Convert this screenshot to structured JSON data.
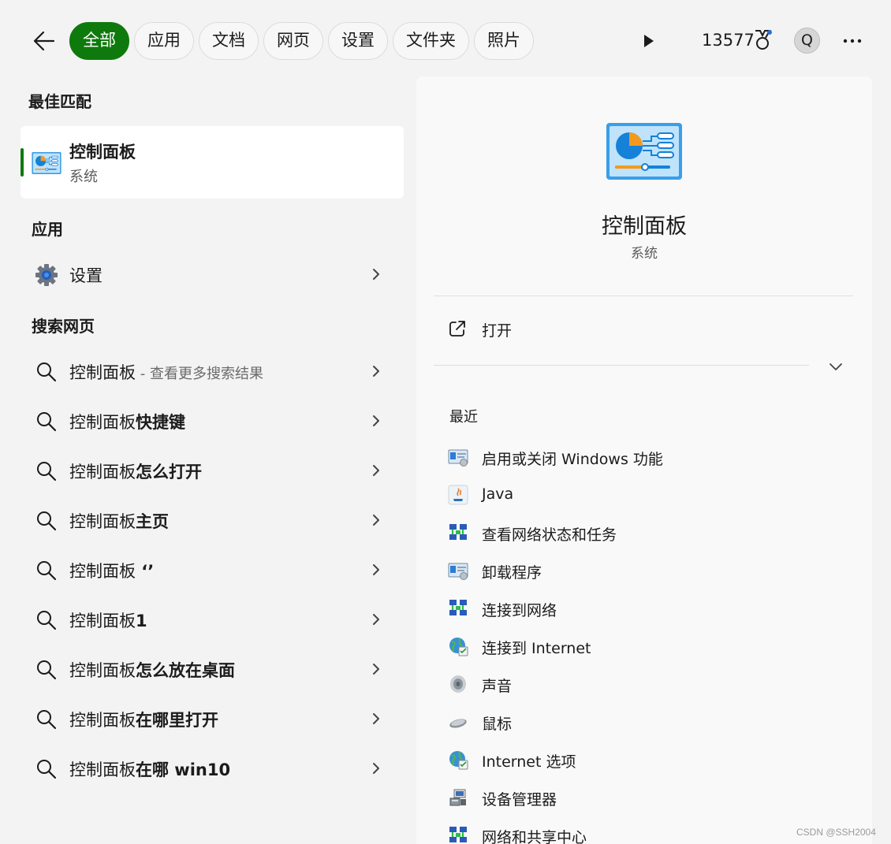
{
  "filters": {
    "tabs": [
      {
        "label": "全部",
        "active": true
      },
      {
        "label": "应用"
      },
      {
        "label": "文档"
      },
      {
        "label": "网页"
      },
      {
        "label": "设置"
      },
      {
        "label": "文件夹"
      },
      {
        "label": "照片"
      }
    ],
    "points": "13577",
    "avatar_letter": "Q"
  },
  "best_match": {
    "section_title": "最佳匹配",
    "title": "控制面板",
    "subtitle": "系统"
  },
  "apps": {
    "section_title": "应用",
    "items": [
      {
        "label": "设置",
        "icon": "gear-icon"
      }
    ]
  },
  "web": {
    "section_title": "搜索网页",
    "items": [
      {
        "prefix": "控制面板",
        "suffix": "",
        "hint": " - 查看更多搜索结果"
      },
      {
        "prefix": "控制面板",
        "suffix": "快捷键",
        "hint": ""
      },
      {
        "prefix": "控制面板",
        "suffix": "怎么打开",
        "hint": ""
      },
      {
        "prefix": "控制面板",
        "suffix": "主页",
        "hint": ""
      },
      {
        "prefix": "控制面板",
        "suffix": " ‘’",
        "hint": ""
      },
      {
        "prefix": "控制面板",
        "suffix": "1",
        "hint": ""
      },
      {
        "prefix": "控制面板",
        "suffix": "怎么放在桌面",
        "hint": ""
      },
      {
        "prefix": "控制面板",
        "suffix": "在哪里打开",
        "hint": ""
      },
      {
        "prefix": "控制面板",
        "suffix": "在哪 win10",
        "hint": ""
      }
    ]
  },
  "detail": {
    "title": "控制面板",
    "subtitle": "系统",
    "open_label": "打开",
    "recent_title": "最近",
    "recent": [
      {
        "label": "启用或关闭 Windows 功能",
        "icon": "programs-icon"
      },
      {
        "label": "Java",
        "icon": "java-icon"
      },
      {
        "label": "查看网络状态和任务",
        "icon": "network-icon"
      },
      {
        "label": "卸载程序",
        "icon": "programs-icon"
      },
      {
        "label": "连接到网络",
        "icon": "network-icon"
      },
      {
        "label": "连接到 Internet",
        "icon": "globe-icon"
      },
      {
        "label": "声音",
        "icon": "speaker-icon"
      },
      {
        "label": "鼠标",
        "icon": "mouse-icon"
      },
      {
        "label": "Internet 选项",
        "icon": "globe-icon"
      },
      {
        "label": "设备管理器",
        "icon": "device-manager-icon"
      },
      {
        "label": "网络和共享中心",
        "icon": "network-icon"
      }
    ]
  },
  "watermark": "CSDN @SSH2004",
  "colors": {
    "accent": "#0e7a0d",
    "background": "#f3f3f3",
    "panel": "#f9f9f9"
  }
}
